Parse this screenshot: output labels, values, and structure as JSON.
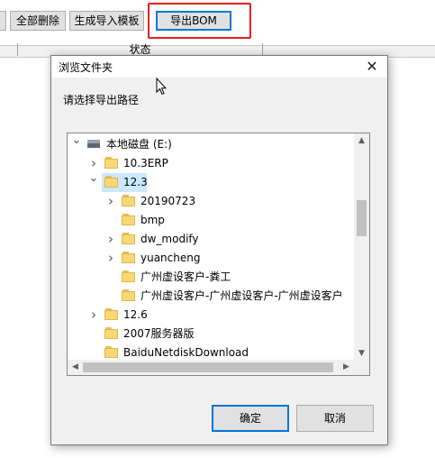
{
  "toolbar": {
    "buttons": [
      "全部删除",
      "生成导入模板",
      "导出BOM"
    ]
  },
  "grid": {
    "header_status": "状态"
  },
  "dialog": {
    "title": "浏览文件夹",
    "close": "✕",
    "prompt": "请选择导出路径",
    "tree": [
      {
        "label": "本地磁盘 (E:)",
        "type": "drive",
        "chevron": "expanded"
      },
      {
        "label": "10.3ERP",
        "type": "folder",
        "chevron": "collapsed"
      },
      {
        "label": "12.3",
        "type": "folder",
        "chevron": "expanded",
        "selected": true
      },
      {
        "label": "20190723",
        "type": "folder",
        "chevron": "collapsed"
      },
      {
        "label": "bmp",
        "type": "folder",
        "chevron": "none"
      },
      {
        "label": "dw_modify",
        "type": "folder",
        "chevron": "collapsed"
      },
      {
        "label": "yuancheng",
        "type": "folder",
        "chevron": "collapsed"
      },
      {
        "label": "广州虚设客户-粪工",
        "type": "folder",
        "chevron": "none"
      },
      {
        "label": "广州虚设客户-广州虚设客户-广州虚设客户",
        "type": "folder",
        "chevron": "none"
      },
      {
        "label": "12.6",
        "type": "folder",
        "chevron": "collapsed"
      },
      {
        "label": "2007服务器版",
        "type": "folder",
        "chevron": "none"
      },
      {
        "label": "BaiduNetdiskDownload",
        "type": "folder",
        "chevron": "none"
      }
    ],
    "ok_label": "确定",
    "cancel_label": "取消"
  },
  "colors": {
    "highlight_box": "#e02020",
    "selection": "#cce8ff",
    "accent": "#0078d7"
  }
}
